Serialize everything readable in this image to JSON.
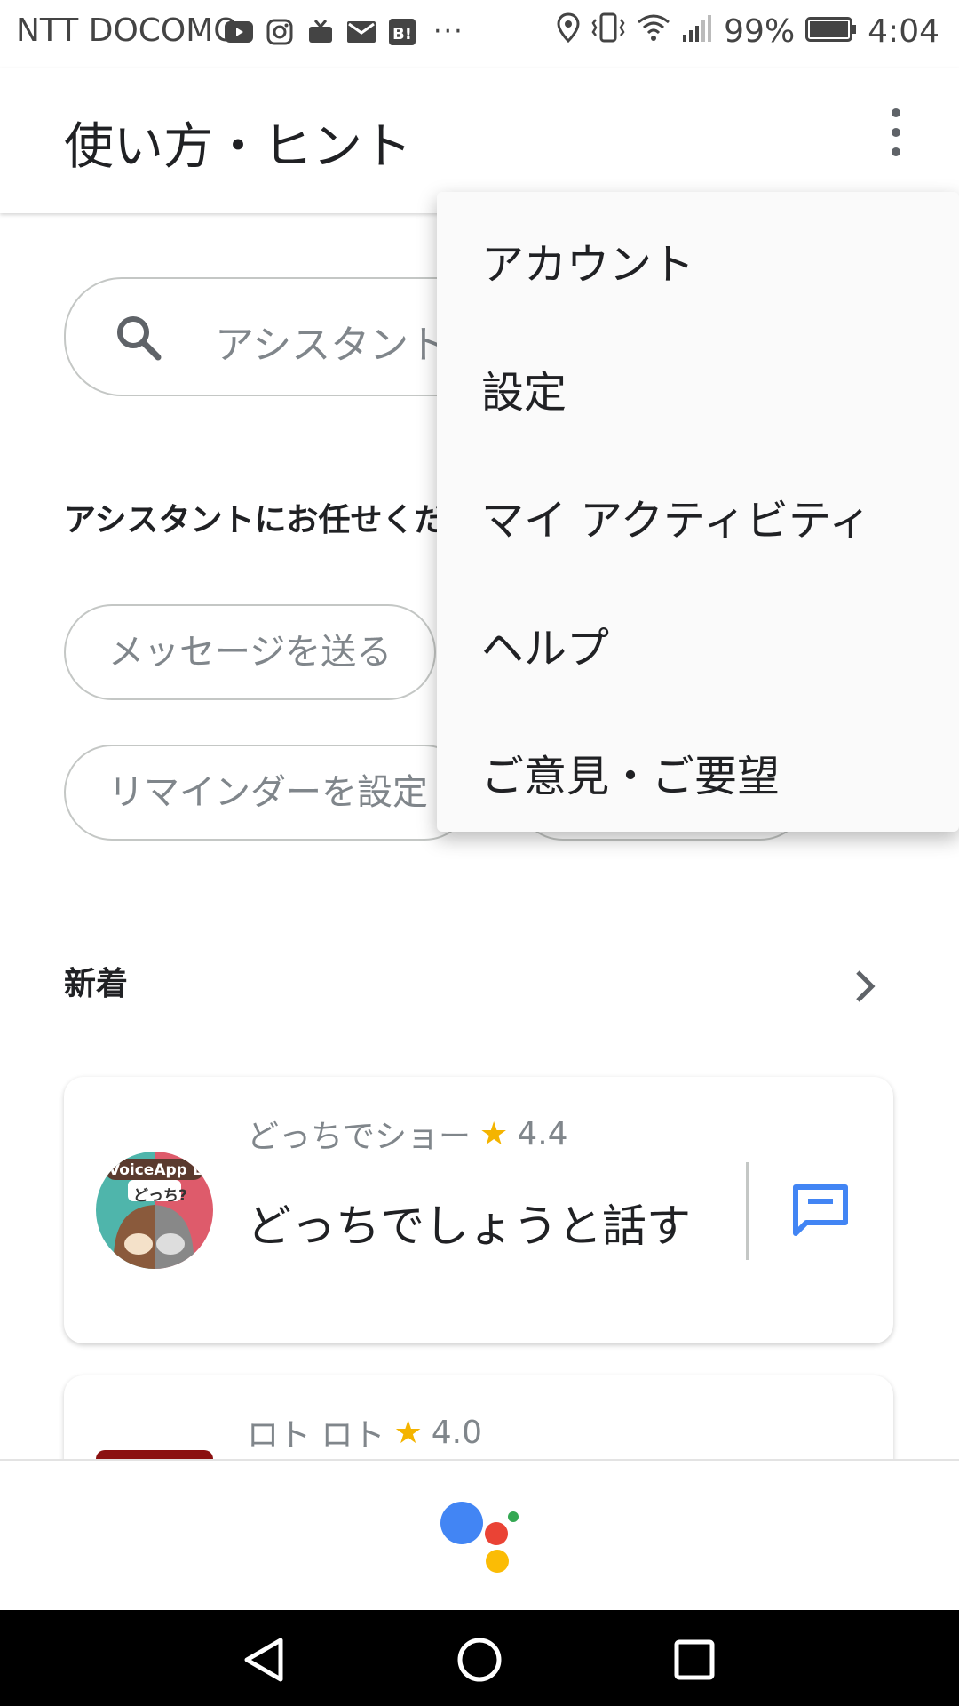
{
  "status_bar": {
    "carrier": "NTT DOCOMO",
    "battery": "99%",
    "time": "4:04",
    "notification_icons": [
      "youtube-icon",
      "instagram-icon",
      "tv-icon",
      "mail-icon",
      "hatena-bookmark-icon"
    ],
    "system_icons": [
      "location-icon",
      "vibrate-icon",
      "wifi-icon",
      "signal-icon",
      "battery-icon"
    ]
  },
  "header": {
    "title": "使い方・ヒント"
  },
  "search": {
    "placeholder": "アシスタント"
  },
  "delegate_section": {
    "heading": "アシスタントにお任せくだ"
  },
  "chips": [
    {
      "label": "メッセージを送る"
    },
    {
      "label": "リマインダーを設定"
    }
  ],
  "new_section": {
    "heading": "新着"
  },
  "cards": [
    {
      "app_name": "どっちでショー",
      "rating": "4.4",
      "action_title": "どっちでしょうと話す",
      "avatar_text": "VoiceApp Lab",
      "avatar_badge": "どっち?"
    },
    {
      "app_name": "ロト ロト",
      "rating": "4.0"
    }
  ],
  "menu": {
    "items": [
      "アカウント",
      "設定",
      "マイ アクティビティ",
      "ヘルプ",
      "ご意見・ご要望"
    ]
  },
  "colors": {
    "google_blue": "#4285f4",
    "google_red": "#ea4335",
    "google_yellow": "#fbbc05",
    "google_green": "#34a853",
    "star": "#f4b400"
  }
}
